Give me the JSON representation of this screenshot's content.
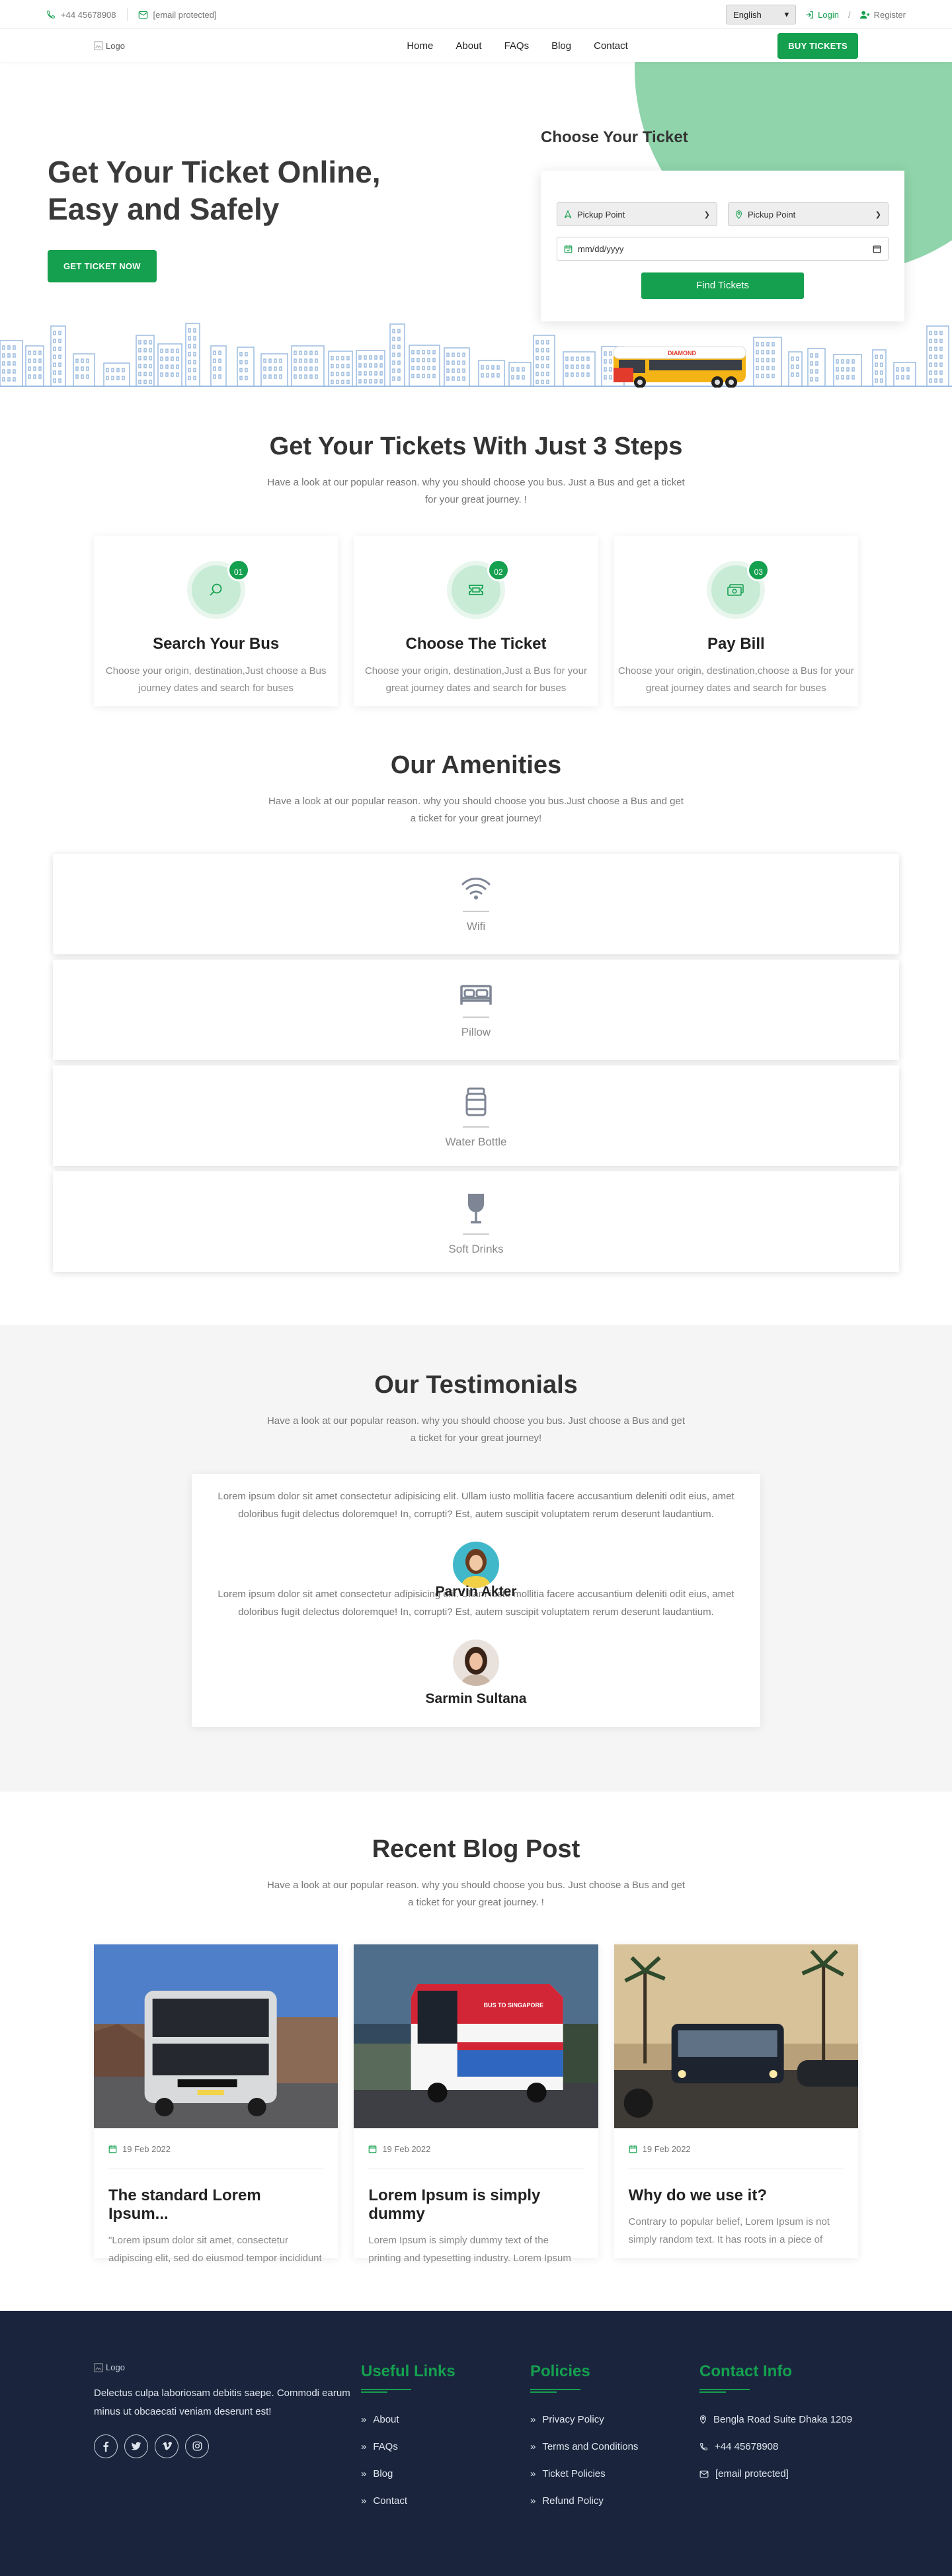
{
  "topbar": {
    "phone": "+44 45678908",
    "email": "[email protected]",
    "language": "English",
    "login": "Login",
    "slash": "/",
    "register": "Register"
  },
  "nav": {
    "logo_alt": "Logo",
    "menu": [
      "Home",
      "About",
      "FAQs",
      "Blog",
      "Contact"
    ],
    "cta": "BUY TICKETS"
  },
  "hero": {
    "title_line1": "Get Your Ticket Online,",
    "title_line2": "Easy and Safely",
    "button": "GET TICKET NOW",
    "form_title": "Choose Your Ticket",
    "pickup_1": "Pickup Point",
    "pickup_2": "Pickup Point",
    "date_placeholder": "mm/dd/yyyy",
    "find_button": "Find Tickets",
    "bus_sign": "DIAMOND"
  },
  "steps": {
    "title": "Get Your Tickets With Just 3 Steps",
    "subtitle": "Have a look at our popular reason. why you should choose you bus. Just a Bus and get a ticket for your great journey. !",
    "items": [
      {
        "num": "01",
        "title": "Search Your Bus",
        "text": "Choose your origin, destination,Just choose a Bus journey dates and search for buses"
      },
      {
        "num": "02",
        "title": "Choose The Ticket",
        "text": "Choose your origin, destination,Just a Bus for your great journey dates and search for buses"
      },
      {
        "num": "03",
        "title": "Pay Bill",
        "text": "Choose your origin, destination,choose a Bus for your great journey dates and search for buses"
      }
    ]
  },
  "amenities": {
    "title": "Our Amenities",
    "subtitle": "Have a look at our popular reason. why you should choose you bus.Just choose a Bus and get a ticket for your great journey!",
    "items": [
      {
        "icon": "wifi-icon",
        "label": "Wifi"
      },
      {
        "icon": "bed-icon",
        "label": "Pillow"
      },
      {
        "icon": "bottle-icon",
        "label": "Water Bottle"
      },
      {
        "icon": "glass-icon",
        "label": "Soft Drinks"
      }
    ]
  },
  "testimonials": {
    "title": "Our Testimonials",
    "subtitle": "Have a look at our popular reason. why you should choose you bus. Just choose a Bus and get a ticket for your great journey!",
    "items": [
      {
        "text": "Lorem ipsum dolor sit amet consectetur adipisicing elit. Ullam iusto mollitia facere accusantium deleniti odit eius, amet doloribus fugit delectus doloremque! In, corrupti? Est, autem suscipit voluptatem rerum deserunt laudantium.",
        "name": "Parvin Akter"
      },
      {
        "text": "Lorem ipsum dolor sit amet consectetur adipisicing elit. Ullam iusto mollitia facere accusantium deleniti odit eius, amet doloribus fugit delectus doloremque! In, corrupti? Est, autem suscipit voluptatem rerum deserunt laudantium.",
        "name": "Sarmin Sultana"
      }
    ]
  },
  "blog": {
    "title": "Recent Blog Post",
    "subtitle": "Have a look at our popular reason. why you should choose you bus. Just choose a Bus and get a ticket for your great journey. !",
    "posts": [
      {
        "date": "19 Feb 2022",
        "title": "The standard Lorem Ipsum...",
        "text": "\"Lorem ipsum dolor sit amet, consectetur adipiscing elit, sed do eiusmod tempor incididunt ut labore et..."
      },
      {
        "date": "19 Feb 2022",
        "title": "Lorem Ipsum is simply dummy",
        "text": "Lorem Ipsum is simply dummy text of the printing and typesetting industry. Lorem Ipsum has been the..."
      },
      {
        "date": "19 Feb 2022",
        "title": "Why do we use it?",
        "text": "Contrary to popular belief, Lorem Ipsum is not simply random text. It has roots in a piece of classical Latin..."
      }
    ],
    "bus_sign": "BUS TO SINGAPORE"
  },
  "footer": {
    "logo_alt": "Logo",
    "about": "Delectus culpa laboriosam debitis saepe. Commodi earum minus ut obcaecati veniam deserunt est!",
    "useful_title": "Useful Links",
    "useful_links": [
      "About",
      "FAQs",
      "Blog",
      "Contact"
    ],
    "policies_title": "Policies",
    "policies": [
      "Privacy Policy",
      "Terms and Conditions",
      "Ticket Policies",
      "Refund Policy"
    ],
    "contact_title": "Contact Info",
    "address": "Bengla Road Suite Dhaka 1209",
    "phone": "+44 45678908",
    "email": "[email protected]"
  },
  "colors": {
    "brand_green": "#15a04f",
    "footer_bg": "#1a253d"
  }
}
